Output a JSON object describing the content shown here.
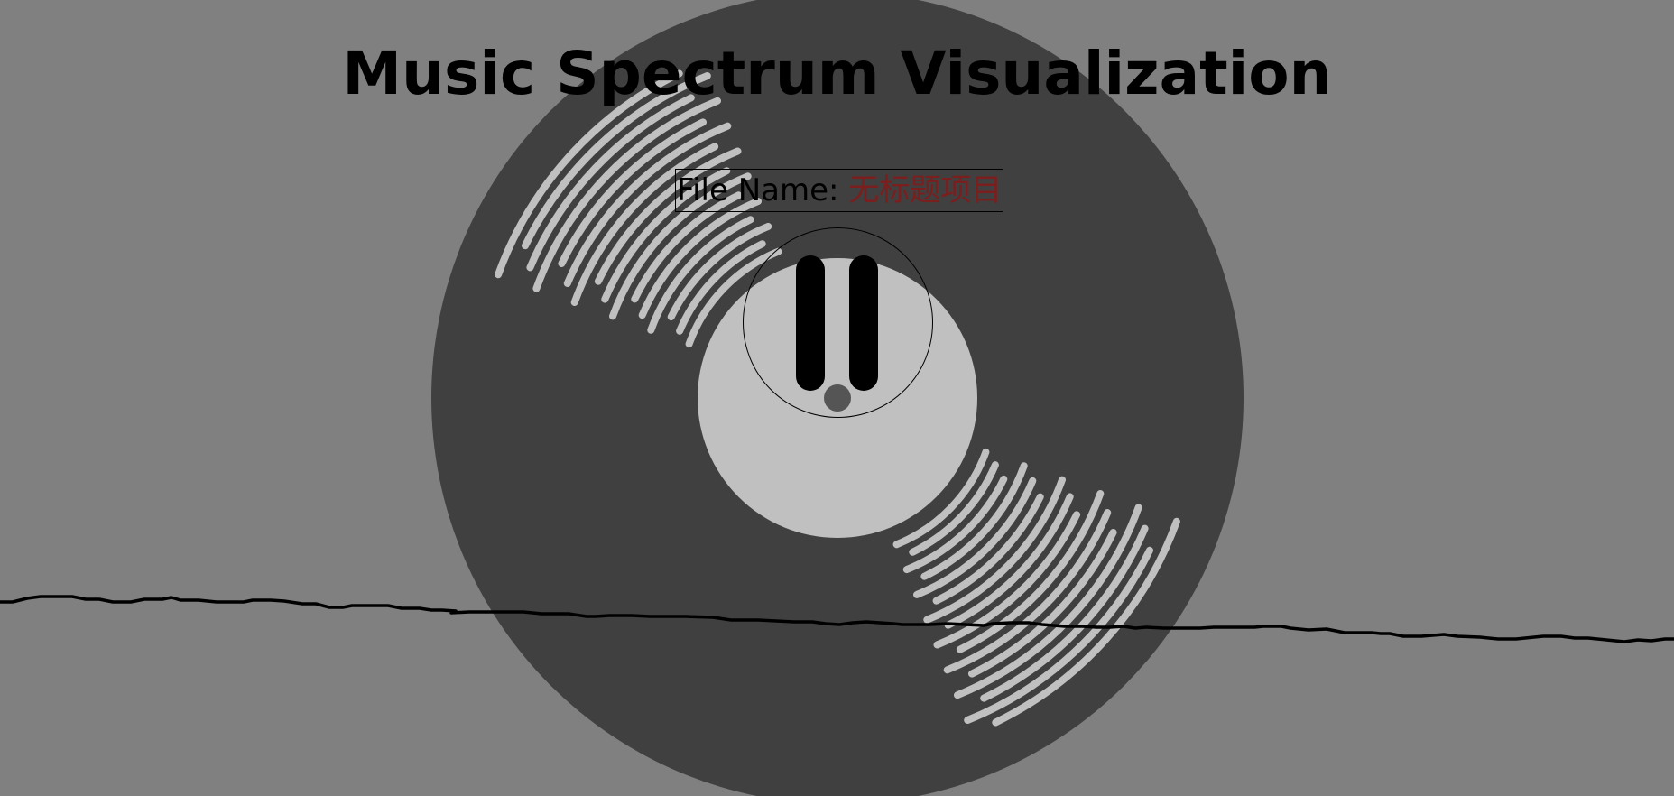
{
  "page": {
    "title": "Music Spectrum Visualization"
  },
  "file": {
    "label": "File Name: ",
    "value": "无标题项目"
  },
  "player": {
    "state_icon": "pause-icon",
    "button_icon": "pause"
  },
  "colors": {
    "background": "#808080",
    "record": "#404040",
    "record_label": "#c0c0c0",
    "grooves": "#c0c0c0",
    "spindle": "#555555",
    "waveform": "#000000",
    "file_value": "#7a1e1e"
  }
}
